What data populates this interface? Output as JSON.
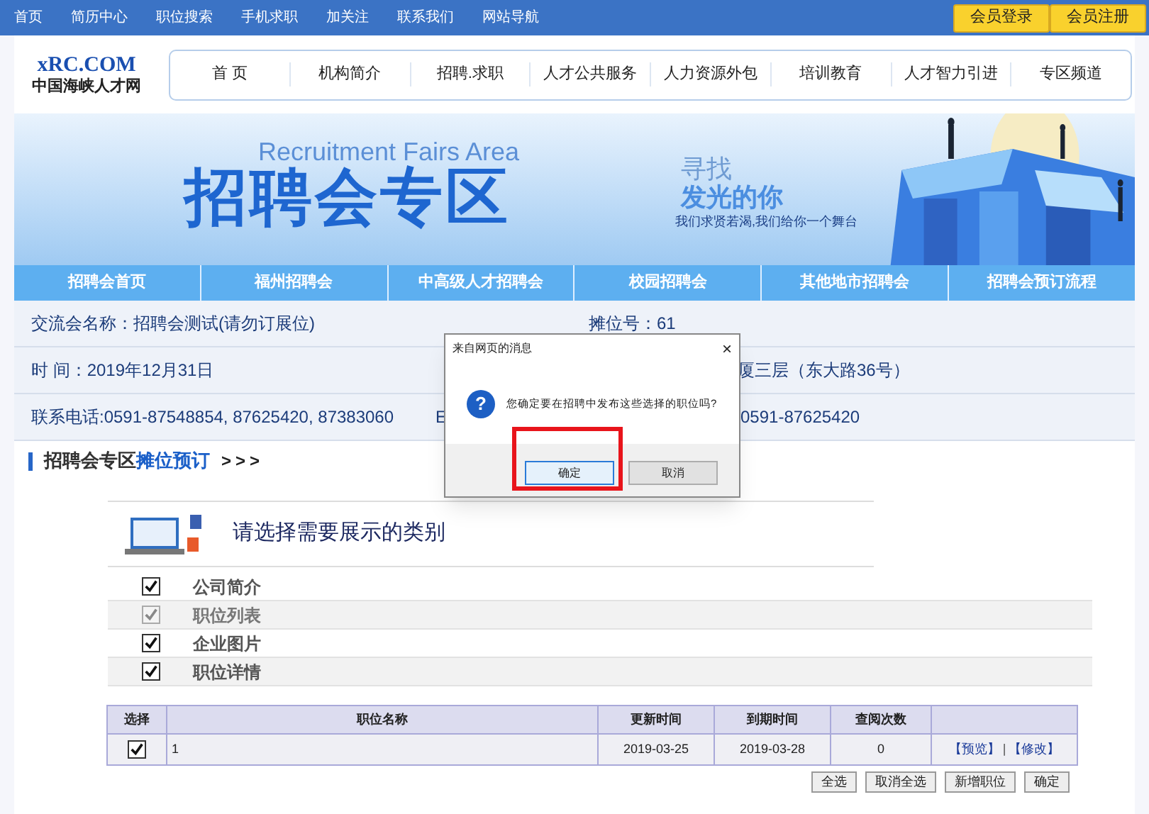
{
  "top_bar": {
    "links": [
      "首页",
      "简历中心",
      "职位搜索",
      "手机求职",
      "加关注",
      "联系我们",
      "网站导航"
    ],
    "buttons": [
      "会员登录",
      "会员注册"
    ]
  },
  "logo": {
    "mark": "xRC.COM",
    "name": "中国海峡人才网"
  },
  "main_nav": [
    "首 页",
    "机构简介",
    "招聘.求职",
    "人才公共服务",
    "人力资源外包",
    "培训教育",
    "人才智力引进",
    "专区频道"
  ],
  "banner": {
    "subtitle": "Recruitment Fairs Area",
    "title": "招聘会专区",
    "tagline_1": "寻找",
    "tagline_2": "发光的你",
    "tagline_3": "我们求贤若渴,我们给你一个舞台"
  },
  "sub_nav": [
    "招聘会首页",
    "福州招聘会",
    "中高级人才招聘会",
    "校园招聘会",
    "其他地市招聘会",
    "招聘会预订流程"
  ],
  "info_rows": [
    {
      "left": "交流会名称：招聘会测试(请勿订展位)",
      "right": [
        "摊位号：61"
      ]
    },
    {
      "left": "时 间：2019年12月31日",
      "right": [
        "厦三层（东大路36号）"
      ]
    },
    {
      "left": "联系电话:0591-87548854, 87625420, 87383060",
      "right": [
        "E",
        "0591-87625420"
      ]
    }
  ],
  "section_title": {
    "text": "招聘会专区",
    "link": "摊位预订",
    "arrows": ">>>"
  },
  "categories": {
    "title": "请选择需要展示的类别",
    "items": [
      {
        "label": "公司简介",
        "checked": true,
        "disabled": false
      },
      {
        "label": "职位列表",
        "checked": true,
        "disabled": true
      },
      {
        "label": "企业图片",
        "checked": true,
        "disabled": false
      },
      {
        "label": "职位详情",
        "checked": true,
        "disabled": false
      }
    ]
  },
  "table": {
    "columns": [
      "选择",
      "职位名称",
      "更新时间",
      "到期时间",
      "查阅次数",
      ""
    ],
    "rows": [
      {
        "checked": true,
        "cells": [
          "",
          "1",
          "2019-03-25",
          "2019-03-28",
          "0"
        ],
        "actions": [
          "【预览】",
          "|",
          "【修改】"
        ]
      }
    ]
  },
  "actions": [
    "全选",
    "取消全选",
    "新增职位",
    "确定"
  ],
  "dialog": {
    "title": "来自网页的消息",
    "close": "×",
    "message": "您确定要在招聘中发布这些选择的职位吗?",
    "icon": "?",
    "buttons": [
      {
        "label": "确定",
        "selected": true,
        "highlighted": true
      },
      {
        "label": "取消",
        "selected": false,
        "highlighted": false
      }
    ]
  }
}
